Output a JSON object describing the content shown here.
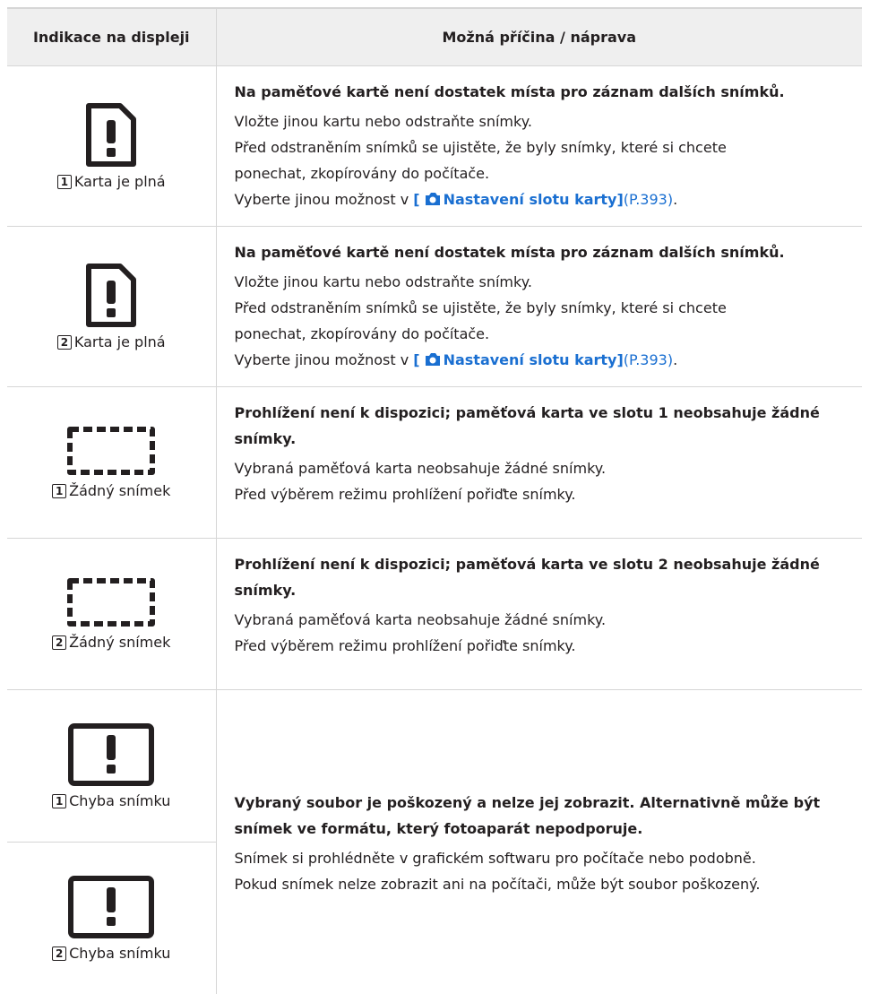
{
  "table": {
    "header": {
      "col1": "Indikace na displeji",
      "col2": "Možná příčina / náprava"
    },
    "rows": [
      {
        "slot": "1",
        "caption": "Karta je plná",
        "title": "Na paměťové kartě není dostatek místa pro záznam dalších snímků.",
        "lines": [
          "Vložte jinou kartu nebo odstraňte snímky.",
          "Před odstraněním snímků se ujistěte, že byly snímky, které si chcete",
          "ponechat, zkopírovány do počítače."
        ],
        "ref": {
          "prefix": "Vyberte jinou možnost v ",
          "label": "[ Nastavení slotu karty]",
          "page": "(P.393)",
          "suffix": "."
        }
      },
      {
        "slot": "2",
        "caption": "Karta je plná",
        "title": "Na paměťové kartě není dostatek místa pro záznam dalších snímků.",
        "lines": [
          "Vložte jinou kartu nebo odstraňte snímky.",
          "Před odstraněním snímků se ujistěte, že byly snímky, které si chcete",
          "ponechat, zkopírovány do počítače."
        ],
        "ref": {
          "prefix": "Vyberte jinou možnost v ",
          "label": "[ Nastavení slotu karty]",
          "page": "(P.393)",
          "suffix": "."
        }
      },
      {
        "slot": "1",
        "caption": "Žádný snímek",
        "title": "Prohlížení není k dispozici; paměťová karta ve slotu 1 neobsahuje žádné snímky.",
        "lines": [
          "Vybraná paměťová karta neobsahuje žádné snímky.",
          "Před výběrem režimu prohlížení pořiďte snímky."
        ]
      },
      {
        "slot": "2",
        "caption": "Žádný snímek",
        "title": "Prohlížení není k dispozici; paměťová karta ve slotu 2 neobsahuje žádné snímky.",
        "lines": [
          "Vybraná paměťová karta neobsahuje žádné snímky.",
          "Před výběrem režimu prohlížení pořiďte snímky."
        ]
      },
      {
        "indicators": [
          {
            "slot": "1",
            "caption": "Chyba snímku"
          },
          {
            "slot": "2",
            "caption": "Chyba snímku"
          }
        ],
        "title": "Vybraný soubor je poškozený a nelze jej zobrazit. Alternativně může být snímek ve formátu, který fotoaparát nepodporuje.",
        "lines": [
          "Snímek si prohlédněte v grafickém softwaru pro počítače nebo podobně.",
          "Pokud snímek nelze zobrazit ani na počítači, může být soubor poškozený."
        ]
      }
    ]
  },
  "icons": {
    "card_full": "card-full-icon",
    "no_image": "no-image-icon",
    "image_error": "image-error-icon",
    "camera": "camera-icon"
  },
  "colors": {
    "link": "#1a6fd1",
    "header_bg": "#efefef",
    "border": "#d6d6d6",
    "text": "#231f20"
  }
}
